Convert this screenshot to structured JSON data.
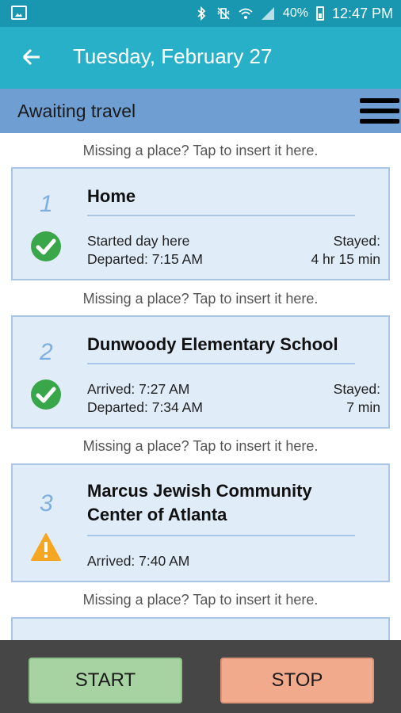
{
  "status_bar": {
    "battery": "40%",
    "time": "12:47 PM"
  },
  "app_bar": {
    "title": "Tuesday, February 27"
  },
  "section": {
    "title": "Awaiting travel"
  },
  "insert_prompt": "Missing a place? Tap to insert it here.",
  "places": [
    {
      "number": "1",
      "name_lines": [
        "Home"
      ],
      "status": "check",
      "line1": "Started day here",
      "line2": "Departed: 7:15 AM",
      "stay_label": "Stayed:",
      "stay_value": "4 hr 15 min"
    },
    {
      "number": "2",
      "name_lines": [
        "Dunwoody Elementary School"
      ],
      "status": "check",
      "line1": "Arrived: 7:27 AM",
      "line2": "Departed: 7:34 AM",
      "stay_label": "Stayed:",
      "stay_value": "7 min"
    },
    {
      "number": "3",
      "name_lines": [
        "Marcus Jewish Community",
        "Center of Atlanta"
      ],
      "status": "warning",
      "line1": "Arrived: 7:40 AM"
    }
  ],
  "colors": {
    "status_bar": "#1a97b0",
    "app_bar": "#28b0c9",
    "section_bar": "#6f9ed3",
    "card_bg": "#e0ecf8",
    "check_green": "#3aa64a",
    "warning_orange": "#f5a623",
    "start_button": "#a7d3a2",
    "stop_button": "#f2aa8d"
  },
  "buttons": {
    "start": "START",
    "stop": "STOP"
  }
}
